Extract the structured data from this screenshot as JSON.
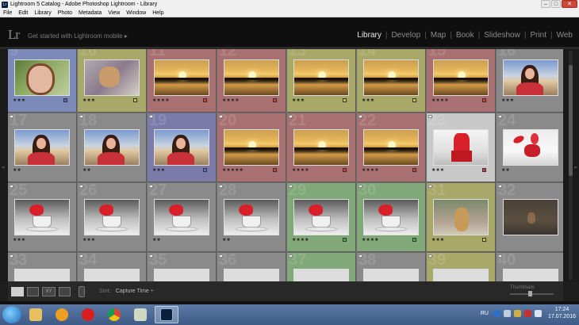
{
  "window": {
    "title": "Lightroom 5 Catalog - Adobe Photoshop Lightroom - Library",
    "app_icon": "lightroom-icon",
    "buttons": [
      "minimize",
      "maximize",
      "close"
    ]
  },
  "menu": [
    "File",
    "Edit",
    "Library",
    "Photo",
    "Metadata",
    "View",
    "Window",
    "Help"
  ],
  "identity": {
    "logo": "Lr",
    "mobile_text": "Get started with Lightroom mobile ▸"
  },
  "modules": {
    "items": [
      "Library",
      "Develop",
      "Map",
      "Book",
      "Slideshow",
      "Print",
      "Web"
    ],
    "active": "Library",
    "separator": "|"
  },
  "grid": {
    "columns": 8,
    "rows": [
      [
        {
          "num": "9",
          "photo": "selfie",
          "stars": "★★★",
          "label": "#5a6ad0",
          "color": "#7b8ab8"
        },
        {
          "num": "10",
          "photo": "dog",
          "stars": "★★★",
          "label": "#c8c83a",
          "color": "#a8a868"
        },
        {
          "num": "11",
          "photo": "sunset",
          "stars": "★★★★",
          "label": "#d83a3a",
          "color": "#a87070"
        },
        {
          "num": "12",
          "photo": "sunset",
          "stars": "★★★★",
          "label": "#d83a3a",
          "color": "#a87070"
        },
        {
          "num": "13",
          "photo": "sunset",
          "stars": "★★★",
          "label": "#c8c83a",
          "color": "#a8a868"
        },
        {
          "num": "14",
          "photo": "sunset",
          "stars": "★★★",
          "label": "#c8c83a",
          "color": "#a8a868"
        },
        {
          "num": "15",
          "photo": "sunset",
          "stars": "★★★★",
          "label": "#d83a3a",
          "color": "#a87070"
        },
        {
          "num": "16",
          "photo": "girl-sunset",
          "stars": "★★★",
          "label": "",
          "color": "#8a8a8a"
        }
      ],
      [
        {
          "num": "17",
          "photo": "girl-sunset",
          "stars": "★★",
          "label": "",
          "color": "#8a8a8a"
        },
        {
          "num": "18",
          "photo": "girl-sunset",
          "stars": "★★",
          "label": "",
          "color": "#8a8a8a"
        },
        {
          "num": "19",
          "photo": "girl-sunset",
          "stars": "★★★",
          "label": "#5a6ad0",
          "color": "#7b7aa8"
        },
        {
          "num": "20",
          "photo": "sunset",
          "stars": "★★★★★",
          "label": "#d83a3a",
          "color": "#a87070"
        },
        {
          "num": "21",
          "photo": "sunset",
          "stars": "★★★★",
          "label": "#d83a3a",
          "color": "#a87070"
        },
        {
          "num": "22",
          "photo": "sunset",
          "stars": "★★★★",
          "label": "#d83a3a",
          "color": "#a87070"
        },
        {
          "num": "23",
          "photo": "redcup",
          "stars": "★★★",
          "label": "#d83a3a",
          "color": "#c8c8c8"
        },
        {
          "num": "24",
          "photo": "redsplash",
          "stars": "★★",
          "label": "",
          "color": "#8a8a8a"
        }
      ],
      [
        {
          "num": "25",
          "photo": "teacup",
          "stars": "★★★",
          "label": "",
          "color": "#8a8a8a"
        },
        {
          "num": "26",
          "photo": "teacup",
          "stars": "★★★",
          "label": "",
          "color": "#8a8a8a"
        },
        {
          "num": "27",
          "photo": "teacup",
          "stars": "★★",
          "label": "",
          "color": "#8a8a8a"
        },
        {
          "num": "28",
          "photo": "teacup",
          "stars": "★★",
          "label": "",
          "color": "#8a8a8a"
        },
        {
          "num": "29",
          "photo": "teacup",
          "stars": "★★★★",
          "label": "#4ab04a",
          "color": "#80a878"
        },
        {
          "num": "30",
          "photo": "teacup",
          "stars": "★★★★",
          "label": "#4ab04a",
          "color": "#80a878"
        },
        {
          "num": "31",
          "photo": "chihuahua",
          "stars": "★★★",
          "label": "#c8c83a",
          "color": "#a8a868"
        },
        {
          "num": "32",
          "photo": "dogdark",
          "stars": "",
          "label": "",
          "color": "#8a8a8a"
        }
      ],
      [
        {
          "num": "33",
          "photo": "plain",
          "stars": "",
          "label": "",
          "color": "#8a8a8a"
        },
        {
          "num": "34",
          "photo": "plain",
          "stars": "",
          "label": "",
          "color": "#8a8a8a"
        },
        {
          "num": "35",
          "photo": "plain",
          "stars": "",
          "label": "",
          "color": "#8a8a8a"
        },
        {
          "num": "36",
          "photo": "plain",
          "stars": "",
          "label": "",
          "color": "#8a8a8a"
        },
        {
          "num": "37",
          "photo": "plain",
          "stars": "",
          "label": "",
          "color": "#80a878"
        },
        {
          "num": "38",
          "photo": "plain",
          "stars": "",
          "label": "",
          "color": "#8a8a8a"
        },
        {
          "num": "39",
          "photo": "plain",
          "stars": "",
          "label": "",
          "color": "#a8a868"
        },
        {
          "num": "40",
          "photo": "plain",
          "stars": "",
          "label": "",
          "color": "#8a8a8a"
        }
      ]
    ]
  },
  "toolbar": {
    "sort_label": "Sort:",
    "sort_value": "Capture Time ÷",
    "thumbnails_label": "Thumbnails",
    "thumbnail_size": 0.45
  },
  "taskbar": {
    "apps": [
      "windows-explorer-icon",
      "media-player-icon",
      "opera-icon",
      "chrome-icon",
      "image-viewer-icon",
      "lightroom-icon"
    ],
    "lang": "RU",
    "time": "17:24",
    "date": "17.07.2016"
  }
}
